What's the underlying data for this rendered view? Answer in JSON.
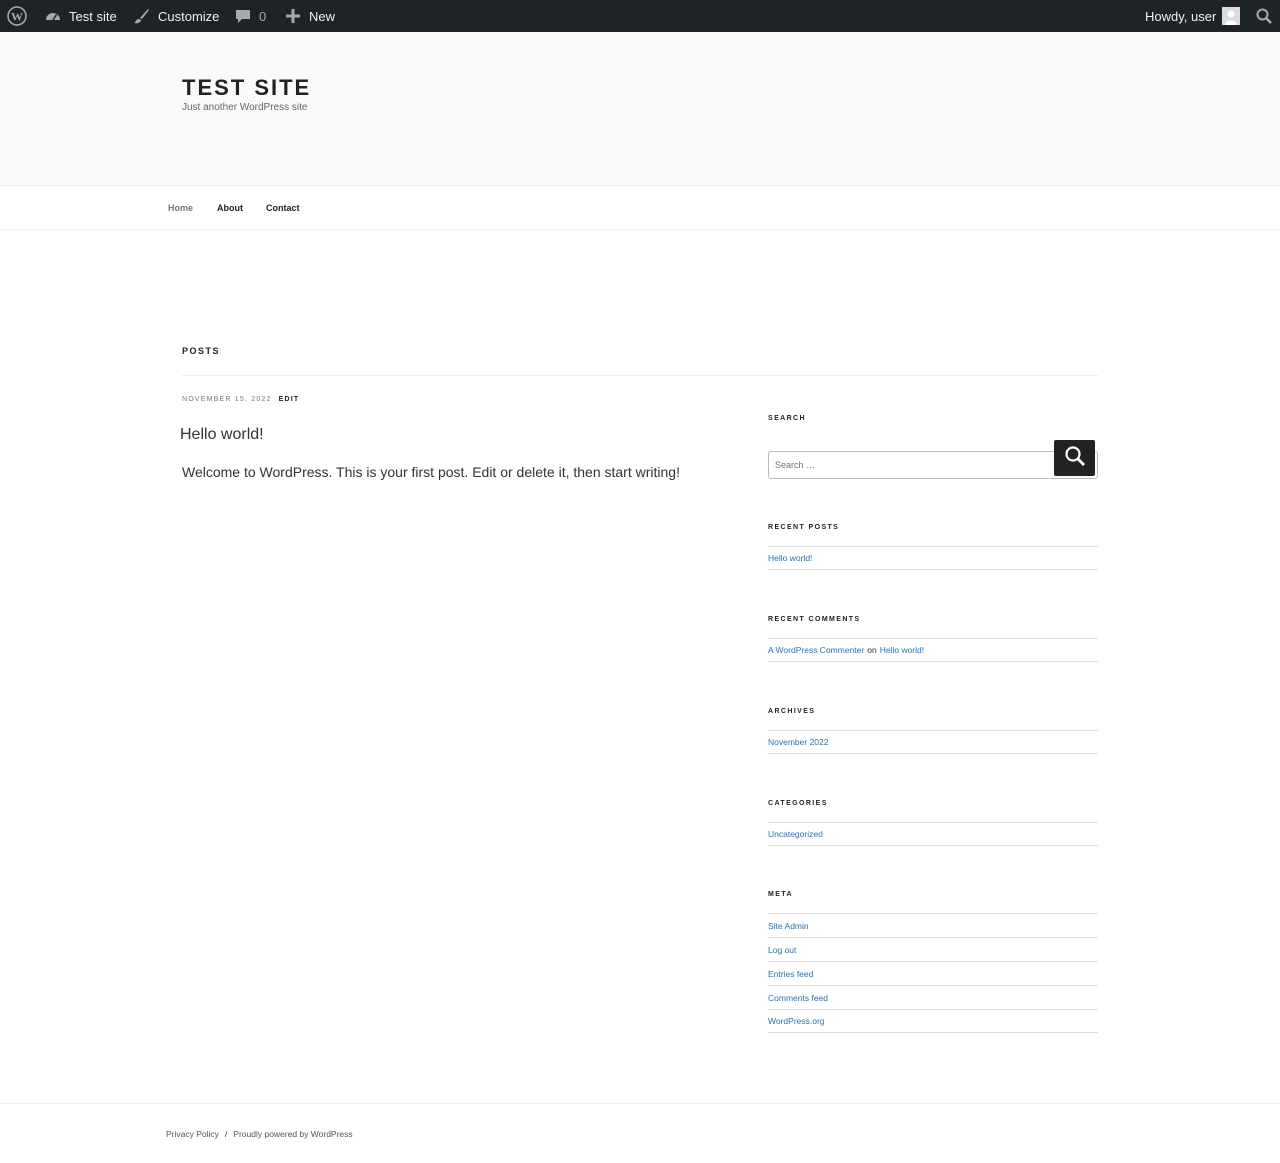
{
  "adminbar": {
    "site_name": "Test site",
    "customize": "Customize",
    "comments_count": "0",
    "new_label": "New",
    "howdy": "Howdy, user"
  },
  "header": {
    "title": "TEST SITE",
    "description": "Just another WordPress site"
  },
  "nav": {
    "items": [
      {
        "label": "Home"
      },
      {
        "label": "About"
      },
      {
        "label": "Contact"
      }
    ]
  },
  "page": {
    "title": "POSTS"
  },
  "post": {
    "date": "NOVEMBER 15, 2022",
    "edit": "EDIT",
    "title": "Hello world!",
    "content": "Welcome to WordPress. This is your first post. Edit or delete it, then start writing!"
  },
  "sidebar": {
    "search_title": "SEARCH",
    "search_placeholder": "Search …",
    "recent_posts_title": "RECENT POSTS",
    "recent_posts": [
      "Hello world!"
    ],
    "recent_comments_title": "RECENT COMMENTS",
    "recent_comment": {
      "author": "A WordPress Commenter",
      "on": "on",
      "post": "Hello world!"
    },
    "archives_title": "ARCHIVES",
    "archives": [
      "November 2022"
    ],
    "categories_title": "CATEGORIES",
    "categories": [
      "Uncategorized"
    ],
    "meta_title": "META",
    "meta": [
      "Site Admin",
      "Log out",
      "Entries feed",
      "Comments feed",
      "WordPress.org"
    ]
  },
  "footer": {
    "privacy": "Privacy Policy",
    "separator": "/",
    "powered": "Proudly powered by WordPress"
  },
  "colors": {
    "adminbar_bg": "#1d2327",
    "link": "#2b72b0",
    "header_bg": "#fafafa"
  }
}
